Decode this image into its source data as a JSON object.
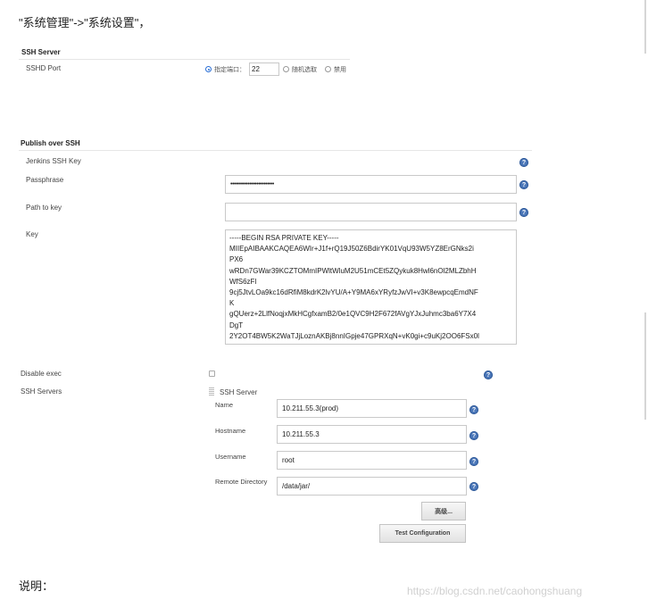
{
  "intro_text": "\"系统管理\"->\"系统设置\"，",
  "ssh_server": {
    "title": "SSH Server",
    "port_label": "SSHD Port",
    "options": [
      {
        "label": "指定端口：",
        "selected": true
      },
      {
        "label": "随机选取",
        "selected": false
      },
      {
        "label": "禁用",
        "selected": false
      }
    ],
    "port_value": "22"
  },
  "publish": {
    "title": "Publish over SSH",
    "jenkins_key_label": "Jenkins SSH Key",
    "passphrase_label": "Passphrase",
    "passphrase_value": "•••••••••••••••••••••••••",
    "path_label": "Path to key",
    "path_value": "",
    "key_label": "Key",
    "key_lines": [
      "-----BEGIN RSA PRIVATE KEY-----",
      "MIIEpAIBAAKCAQEA6WIr+J1f+rQ19J50Z6BdirYK01VqU93W5YZ8ErGNks2i",
      "PX6",
      "wRDn7GWar39KCZTOMmIPWltWluM2U51mCEt5ZQykuk8Hwl6nOl2MLZbhH",
      "WfS6zFl",
      "9cj5JtvLOa9kc16dRfiM8kdrK2lvYU/A+Y9MA6xYRyfzJwVI+v3K8ewpcqEmdNF",
      "K",
      "gQUerz+2LlfNoqjxMkHCgfxamB2/0e1QVC9H2F672fAVgYJxJuhmc3ba6Y7X4",
      "DgT",
      "2Y2OT4BW5K2WaTJjLoznAKBj8nnIGpje47GPRXqN+vK0gi+c9uKj2OO6FSx0l"
    ],
    "disable_exec_label": "Disable exec",
    "ssh_servers_label": "SSH Servers",
    "ssh_server_header": "SSH Server",
    "server": {
      "name_label": "Name",
      "name_value": "10.211.55.3(prod)",
      "hostname_label": "Hostname",
      "hostname_value": "10.211.55.3",
      "username_label": "Username",
      "username_value": "root",
      "remote_dir_label": "Remote Directory",
      "remote_dir_value": "/data/jar/"
    },
    "advanced_label": "高级...",
    "test_label": "Test Configuration"
  },
  "help_glyph": "?",
  "footer_text": "说明：",
  "watermark": "https://blog.csdn.net/caohongshuang",
  "colors": {
    "help": "#4a76b8",
    "radio_selected": "#2a6fd6"
  }
}
